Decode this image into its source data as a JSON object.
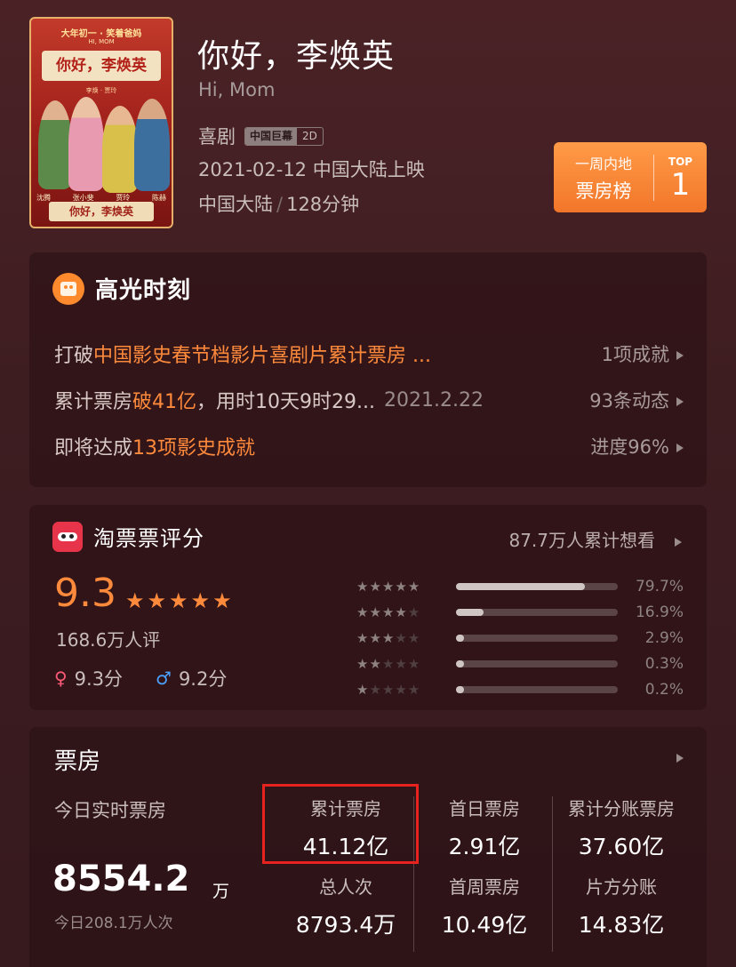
{
  "poster": {
    "top_text": "大年初一 · 笑着爸妈",
    "sub_text": "HI, MOM",
    "title": "你好，李焕英",
    "names": "李焕 · 贾玲",
    "cast_labels": [
      "沈腾",
      "张小斐",
      "贾玲",
      "陈赫"
    ],
    "bottom_title": "你好，李焕英"
  },
  "movie": {
    "title": "你好，李焕英",
    "english_title": "Hi, Mom",
    "genre": "喜剧",
    "format_tag": "中国巨幕",
    "dim_tag": "2D",
    "release": "2021-02-12 中国大陆上映",
    "region": "中国大陆",
    "duration": "128分钟"
  },
  "rank": {
    "line1": "一周内地",
    "line2": "票房榜",
    "top_label": "TOP",
    "number": "1"
  },
  "highlights": {
    "title": "高光时刻",
    "rows": [
      {
        "prefix": "打破 ",
        "highlight": "中国影史春节档影片喜剧片累计票房 ...",
        "suffix": "",
        "date": "",
        "right": "1项成就"
      },
      {
        "prefix": "累计票房 ",
        "highlight": "破41亿",
        "suffix": "，用时10天9时29...",
        "date": "2021.2.22",
        "right": "93条动态"
      },
      {
        "prefix": "即将达成 ",
        "highlight": "13项影史成就",
        "suffix": "",
        "date": "",
        "right": "进度96%"
      }
    ]
  },
  "rating": {
    "title": "淘票票评分",
    "want": "87.7万人累计想看",
    "score": "9.3",
    "raters": "168.6万人评",
    "female_score": "9.3分",
    "male_score": "9.2分",
    "distribution": [
      {
        "stars": 5,
        "percent_text": "79.7%",
        "fraction": 0.797
      },
      {
        "stars": 4,
        "percent_text": "16.9%",
        "fraction": 0.169
      },
      {
        "stars": 3,
        "percent_text": "2.9%",
        "fraction": 0.029
      },
      {
        "stars": 2,
        "percent_text": "0.3%",
        "fraction": 0.003
      },
      {
        "stars": 1,
        "percent_text": "0.2%",
        "fraction": 0.002
      }
    ]
  },
  "boxoffice": {
    "title": "票房",
    "today_label": "今日实时票房",
    "today_value": "8554.2",
    "today_unit": "万",
    "today_people": "今日208.1万人次",
    "stats": [
      {
        "label": "累计票房",
        "value": "41.12亿"
      },
      {
        "label": "首日票房",
        "value": "2.91亿"
      },
      {
        "label": "累计分账票房",
        "value": "37.60亿"
      },
      {
        "label": "总人次",
        "value": "8793.4万"
      },
      {
        "label": "首周票房",
        "value": "10.49亿"
      },
      {
        "label": "片方分账",
        "value": "14.83亿"
      }
    ]
  },
  "colors": {
    "accent_orange": "#ff8a3c",
    "highlight_red": "#e8231f",
    "female": "#ff5a78",
    "male": "#4da2ff"
  }
}
